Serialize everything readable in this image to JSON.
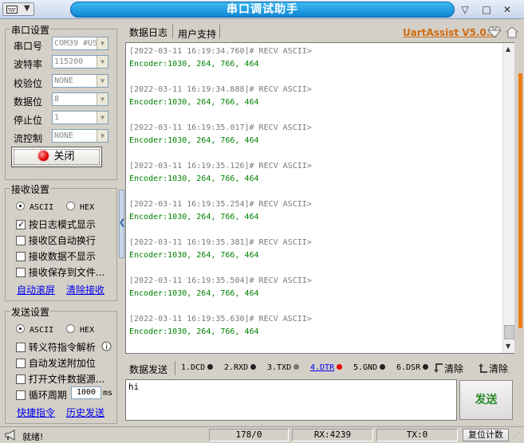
{
  "window": {
    "title": "串口调试助手",
    "controls": [
      "▽",
      "□",
      "✕"
    ]
  },
  "serial": {
    "group_title": "串口设置",
    "port_label": "串口号",
    "port_value": "COM39 #US",
    "baud_label": "波特率",
    "baud_value": "115200",
    "parity_label": "校验位",
    "parity_value": "NONE",
    "databits_label": "数据位",
    "databits_value": "8",
    "stopbits_label": "停止位",
    "stopbits_value": "1",
    "flow_label": "流控制",
    "flow_value": "NONE",
    "close_label": "关闭",
    "led_color": "#e00000"
  },
  "receive": {
    "group_title": "接收设置",
    "ascii": "ASCII",
    "hex": "HEX",
    "opt_log_mode": "按日志模式显示",
    "opt_auto_wrap": "接收区自动换行",
    "opt_hide": "接收数据不显示",
    "opt_save": "接收保存到文件...",
    "link_auto_scroll": "自动滚屏",
    "link_clear": "清除接收"
  },
  "send": {
    "group_title": "发送设置",
    "ascii": "ASCII",
    "hex": "HEX",
    "opt_escape": "转义符指令解析",
    "opt_append": "自动发送附加位",
    "opt_file": "打开文件数据源...",
    "opt_loop": "循环周期",
    "loop_value": "1000",
    "loop_unit": "ms",
    "link_shortcut": "快捷指令",
    "link_history": "历史发送"
  },
  "tabs": {
    "log": "数据日志",
    "user": "用户支持",
    "brand": "UartAssist V5.0.2"
  },
  "log": [
    {
      "head": "[2022-03-11 16:19:34.760]# RECV ASCII>",
      "body": "Encoder:1030, 264, 766, 464"
    },
    {
      "head": "[2022-03-11 16:19:34.888]# RECV ASCII>",
      "body": "Encoder:1030, 264, 766, 464"
    },
    {
      "head": "[2022-03-11 16:19:35.017]# RECV ASCII>",
      "body": "Encoder:1030, 264, 766, 464"
    },
    {
      "head": "[2022-03-11 16:19:35.126]# RECV ASCII>",
      "body": "Encoder:1030, 264, 766, 464"
    },
    {
      "head": "[2022-03-11 16:19:35.254]# RECV ASCII>",
      "body": "Encoder:1030, 264, 766, 464"
    },
    {
      "head": "[2022-03-11 16:19:35.381]# RECV ASCII>",
      "body": "Encoder:1030, 264, 766, 464"
    },
    {
      "head": "[2022-03-11 16:19:35.504]# RECV ASCII>",
      "body": "Encoder:1030, 264, 766, 464"
    },
    {
      "head": "[2022-03-11 16:19:35.630]# RECV ASCII>",
      "body": "Encoder:1030, 264, 766, 464"
    }
  ],
  "sendbar": {
    "tab": "数据发送",
    "dcd": "1.DCD",
    "rxd": "2.RXD",
    "txd": "3.TXD",
    "dtr": "4.DTR",
    "gnd": "5.GND",
    "dsr": "6.DSR",
    "clear1": "清除",
    "clear2": "清除"
  },
  "send_text": "hi",
  "send_button": "发送",
  "status": {
    "ready": "就绪!",
    "count": "178/0",
    "rx": "RX:4239",
    "tx": "TX:0",
    "reset": "复位计数"
  }
}
